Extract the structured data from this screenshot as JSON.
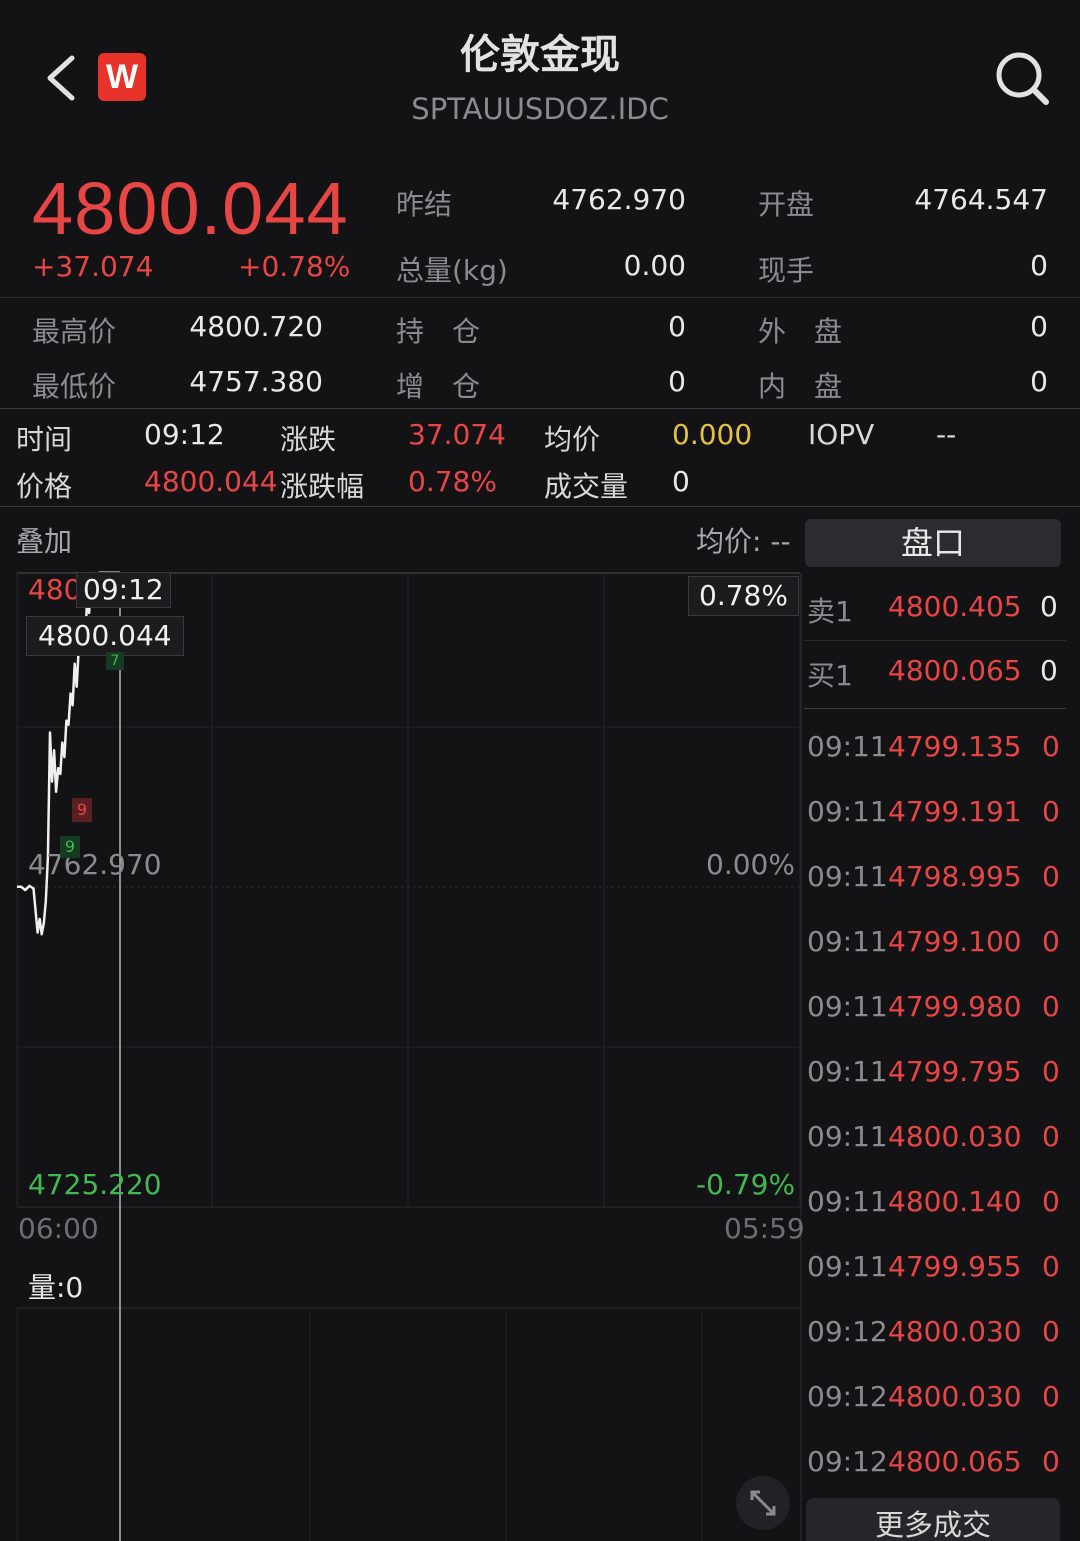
{
  "header": {
    "title": "伦敦金现",
    "subtitle": "SPTAUUSDOZ.IDC",
    "logo_letter": "W"
  },
  "quote": {
    "price": "4800.044",
    "change_abs": "+37.074",
    "change_pct": "+0.78%",
    "prev_settle_label": "昨结",
    "prev_settle": "4762.970",
    "open_label": "开盘",
    "open": "4764.547",
    "volume_label": "总量(kg)",
    "volume": "0.00",
    "current_hand_label": "现手",
    "current_hand": "0",
    "high_label": "最高价",
    "high": "4800.720",
    "position_label": "持　仓",
    "position": "0",
    "outer_label": "外　盘",
    "outer": "0",
    "low_label": "最低价",
    "low": "4757.380",
    "pos_change_label": "增　仓",
    "pos_change": "0",
    "inner_label": "内　盘",
    "inner": "0"
  },
  "crosshair_info": {
    "time_label": "时间",
    "time": "09:12",
    "change_label": "涨跌",
    "change": "37.074",
    "avg_label": "均价",
    "avg": "0.000",
    "iopv_label": "IOPV",
    "iopv": "--",
    "price_label": "价格",
    "price": "4800.044",
    "pct_label": "涨跌幅",
    "pct": "0.78%",
    "vol_label": "成交量",
    "vol": "0"
  },
  "chart": {
    "overlay_label": "叠加",
    "avg_price_label": "均价: --",
    "top_price_partial": "480",
    "tooltip_time": "09:12",
    "tooltip_price": "4800.044",
    "top_pct": "0.78%",
    "mid_price": "4762.970",
    "mid_pct": "0.00%",
    "bottom_price": "4725.220",
    "bottom_pct": "-0.79%",
    "start_time": "06:00",
    "end_time": "05:59",
    "volume_label": "量:0",
    "marker_red": "9",
    "marker_green_top": "7",
    "marker_green_low": "9"
  },
  "chart_data": {
    "type": "line",
    "xlabel": "",
    "ylabel": "",
    "x_range": [
      "06:00",
      "05:59"
    ],
    "ylim": [
      4725.22,
      4800.72
    ],
    "baseline": 4762.97,
    "series": [
      {
        "x": [
          0,
          4,
          8,
          12,
          16,
          20,
          22,
          24,
          26,
          28,
          30,
          32,
          34,
          36,
          38,
          40,
          42,
          44,
          46,
          48,
          50,
          52,
          54,
          56,
          58,
          60,
          62,
          64,
          66,
          68,
          70,
          72,
          74,
          76,
          78,
          80,
          82,
          84,
          86,
          88,
          90,
          92,
          94,
          96,
          98,
          100
        ],
        "y": [
          4763.0,
          4763.0,
          4762.6,
          4763.1,
          4762.8,
          4757.6,
          4759.2,
          4757.4,
          4758.7,
          4761.3,
          4766.5,
          4781.2,
          4775.4,
          4779.1,
          4774.2,
          4777.0,
          4776.3,
          4780.0,
          4778.3,
          4782.6,
          4782.1,
          4785.8,
          4784.4,
          4789.3,
          4786.6,
          4791.3,
          4790.4,
          4793.5,
          4791.7,
          4796.5,
          4795.3,
          4798.7,
          4797.8,
          4800.0,
          4799.6,
          4800.044,
          4800.044,
          4800.044,
          4800.044,
          4800.044,
          4800.044,
          4800.044,
          4800.044,
          4800.044,
          4800.044,
          4800.044
        ]
      }
    ]
  },
  "orderbook": {
    "tab_label": "盘口",
    "ask_label": "卖1",
    "ask_price": "4800.405",
    "ask_vol": "0",
    "bid_label": "买1",
    "bid_price": "4800.065",
    "bid_vol": "0",
    "trades": [
      {
        "time": "09:11",
        "price": "4799.135",
        "vol": "0"
      },
      {
        "time": "09:11",
        "price": "4799.191",
        "vol": "0"
      },
      {
        "time": "09:11",
        "price": "4798.995",
        "vol": "0"
      },
      {
        "time": "09:11",
        "price": "4799.100",
        "vol": "0"
      },
      {
        "time": "09:11",
        "price": "4799.980",
        "vol": "0"
      },
      {
        "time": "09:11",
        "price": "4799.795",
        "vol": "0"
      },
      {
        "time": "09:11",
        "price": "4800.030",
        "vol": "0"
      },
      {
        "time": "09:11",
        "price": "4800.140",
        "vol": "0"
      },
      {
        "time": "09:11",
        "price": "4799.955",
        "vol": "0"
      },
      {
        "time": "09:12",
        "price": "4800.030",
        "vol": "0"
      },
      {
        "time": "09:12",
        "price": "4800.030",
        "vol": "0"
      },
      {
        "time": "09:12",
        "price": "4800.065",
        "vol": "0"
      }
    ],
    "more_label": "更多成交"
  },
  "colors": {
    "up": "#e84545",
    "down": "#3fb950",
    "avg": "#e5c13f",
    "bg": "#131315"
  }
}
